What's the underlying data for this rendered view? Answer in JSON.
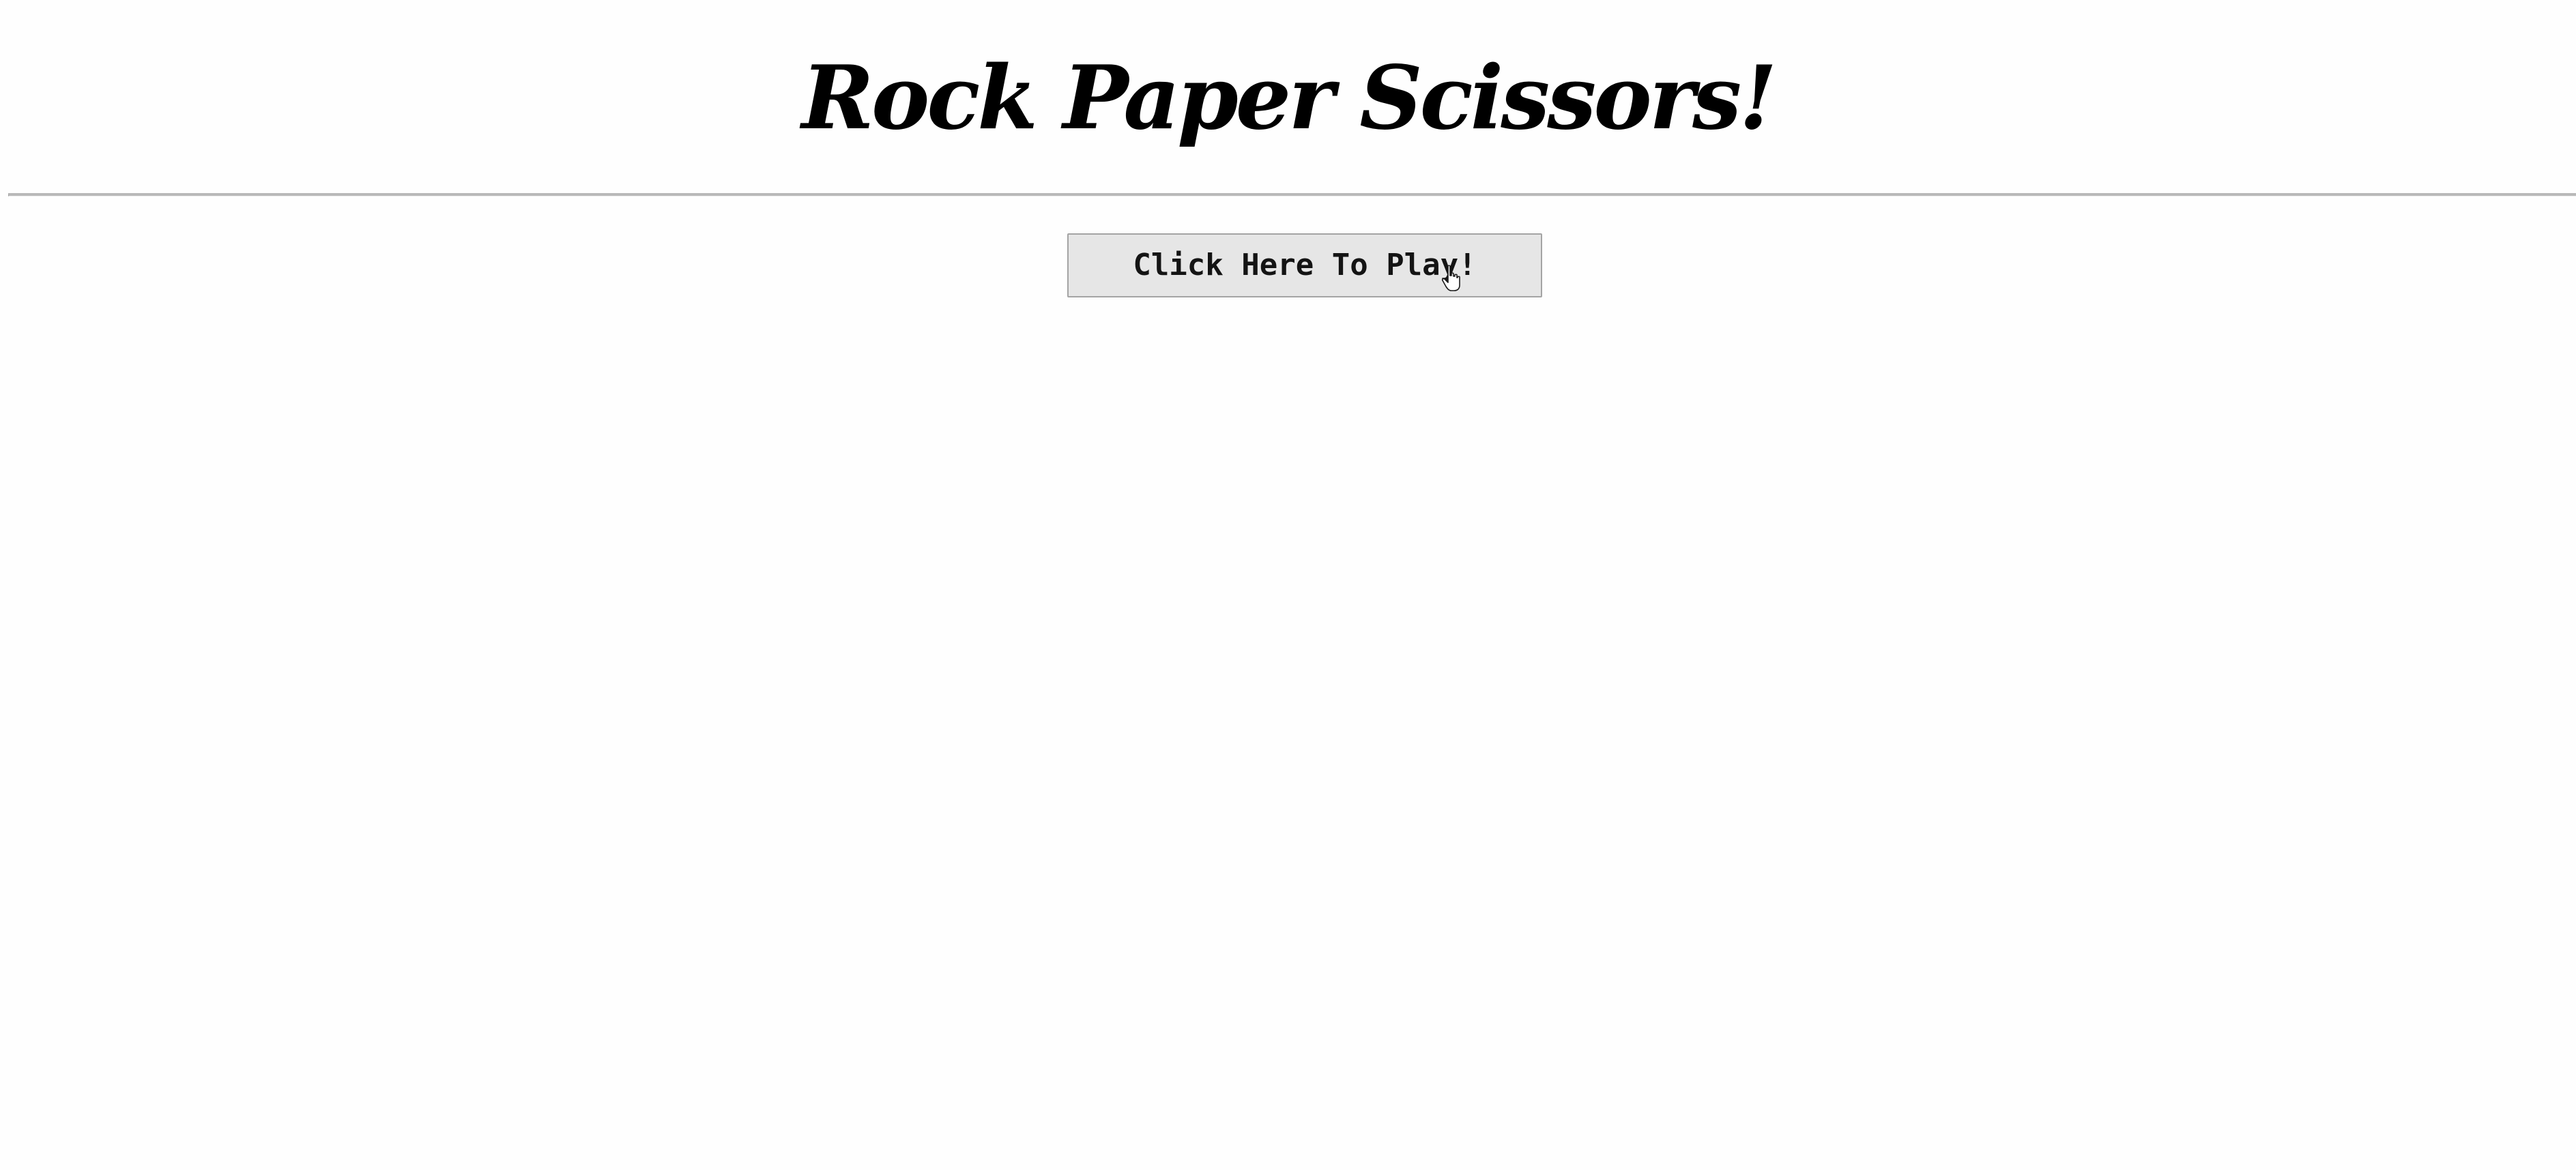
{
  "header": {
    "title": "Rock Paper Scissors!"
  },
  "main": {
    "play_button_label": "Click Here To Play!"
  },
  "colors": {
    "background": "#fefefe",
    "title_text": "#000000",
    "divider": "#b9b9b9",
    "button_bg": "#e6e6e6",
    "button_border": "#a4a4a4"
  },
  "icons": {
    "cursor": "hand-pointer-icon"
  }
}
